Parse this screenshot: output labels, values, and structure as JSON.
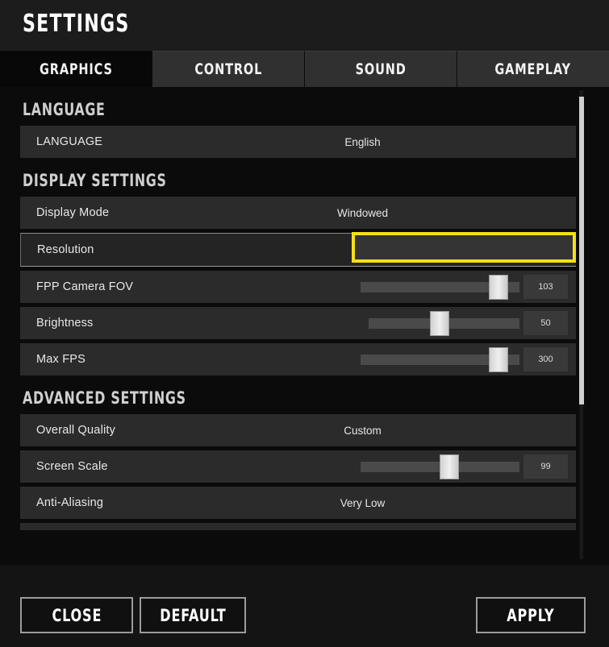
{
  "header": {
    "title": "SETTINGS"
  },
  "tabs": [
    {
      "label": "GRAPHICS",
      "active": true
    },
    {
      "label": "CONTROL",
      "active": false
    },
    {
      "label": "SOUND",
      "active": false
    },
    {
      "label": "GAMEPLAY",
      "active": false
    }
  ],
  "sections": [
    {
      "title": "LANGUAGE",
      "rows": [
        {
          "label": "LANGUAGE",
          "type": "value",
          "value": "English"
        }
      ]
    },
    {
      "title": "DISPLAY SETTINGS",
      "rows": [
        {
          "label": "Display Mode",
          "type": "value",
          "value": "Windowed"
        },
        {
          "label": "Resolution",
          "type": "highlight",
          "value": "",
          "focused": true
        },
        {
          "label": "FPP Camera FOV",
          "type": "slider",
          "value": "103",
          "percent": 87
        },
        {
          "label": "Brightness",
          "type": "slider",
          "value": "50",
          "percent": 47
        },
        {
          "label": "Max FPS",
          "type": "slider",
          "value": "300",
          "percent": 87
        }
      ]
    },
    {
      "title": "ADVANCED SETTINGS",
      "rows": [
        {
          "label": "Overall Quality",
          "type": "value",
          "value": "Custom"
        },
        {
          "label": "Screen Scale",
          "type": "slider",
          "value": "99",
          "percent": 56
        },
        {
          "label": "Anti-Aliasing",
          "type": "value",
          "value": "Very Low"
        },
        {
          "label": "",
          "type": "partial",
          "value": ""
        }
      ]
    }
  ],
  "scrollbar": {
    "thumb_top_pct": 1,
    "thumb_height_pct": 65
  },
  "footer": {
    "close_label": "CLOSE",
    "default_label": "DEFAULT",
    "apply_label": "APPLY"
  },
  "colors": {
    "highlight": "#f5e017",
    "row_bg": "#2b2b2b",
    "page_bg": "#0b0b0b",
    "tab_inactive": "#303030",
    "tab_active": "#080808"
  }
}
